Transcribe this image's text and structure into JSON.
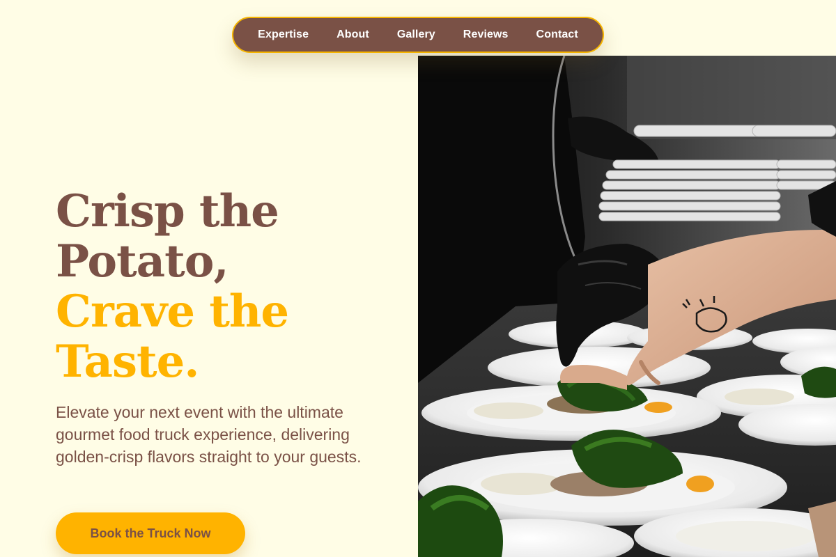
{
  "nav": {
    "items": [
      {
        "label": "Expertise"
      },
      {
        "label": "About"
      },
      {
        "label": "Gallery"
      },
      {
        "label": "Reviews"
      },
      {
        "label": "Contact"
      }
    ]
  },
  "hero": {
    "title_line1": "Crisp the",
    "title_line2": "Potato,",
    "title_line3": "Crave the",
    "title_line4": "Taste.",
    "description": "Elevate your next event with the ultimate gourmet food truck experience, delivering golden-crisp flavors straight to your guests.",
    "cta_label": "Book the Truck Now",
    "image_subject": "chefs-plating-dishes-photo"
  },
  "colors": {
    "background": "#fffde6",
    "brown": "#7a5146",
    "gold": "#ffb300"
  }
}
